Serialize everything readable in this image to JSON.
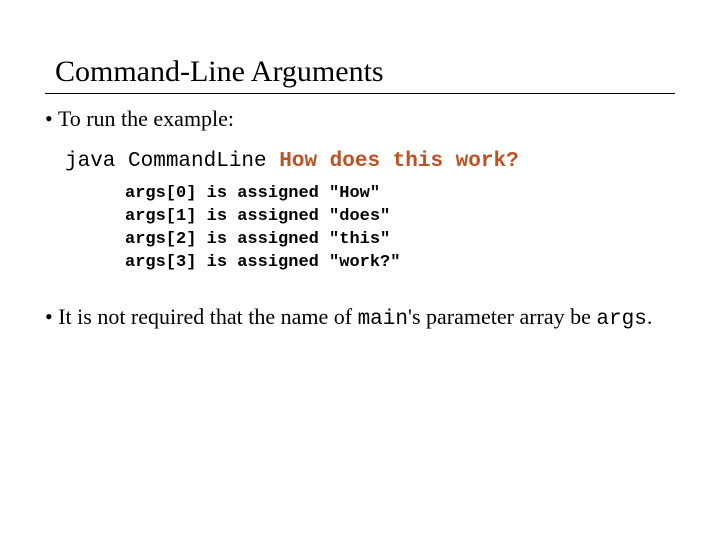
{
  "title": "Command-Line Arguments",
  "bullet1": "To run the example:",
  "command": {
    "prefix": "java CommandLine ",
    "args": "How does this work?"
  },
  "assignments": [
    {
      "var": "args[0]",
      "mid": " is assigned ",
      "val": "\"How\""
    },
    {
      "var": "args[1]",
      "mid": " is assigned ",
      "val": "\"does\""
    },
    {
      "var": "args[2]",
      "mid": " is assigned ",
      "val": "\"this\""
    },
    {
      "var": "args[3]",
      "mid": " is assigned ",
      "val": "\"work?\""
    }
  ],
  "note": {
    "part1": "It is not required that the name of ",
    "code1": "main",
    "part2": "'s parameter array be ",
    "code2": "args",
    "part3": "."
  }
}
